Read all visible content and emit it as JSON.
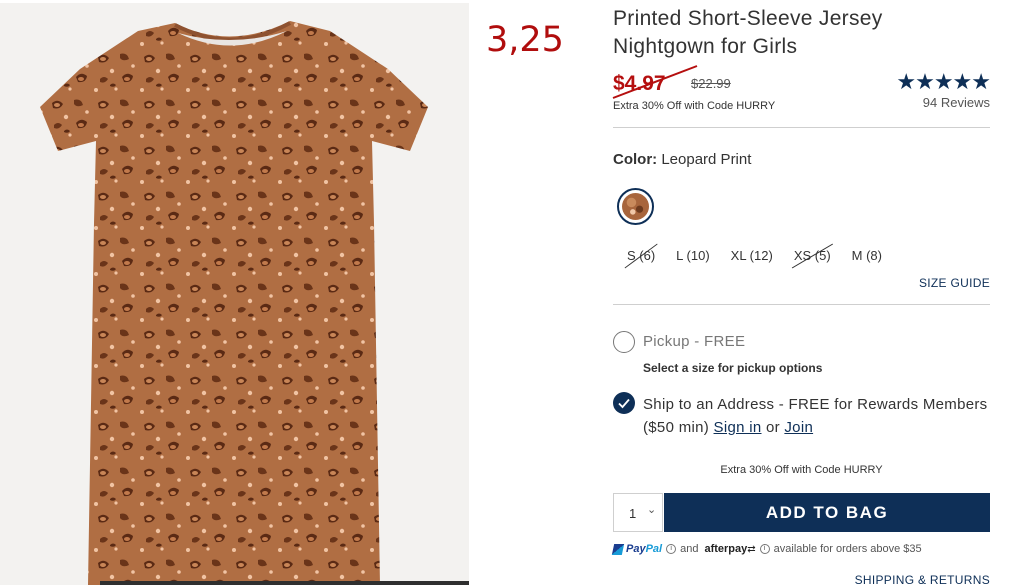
{
  "overlay": {
    "manual_price": "3,25"
  },
  "product": {
    "title": "Printed Short-Sleeve Jersey Nightgown for Girls",
    "price_now": "$4.97",
    "price_was": "$22.99",
    "promo_small": "Extra 30% Off with Code HURRY",
    "rating": {
      "stars": "★★★★★",
      "stars_value": 5,
      "reviews": "94 Reviews"
    },
    "color_label": "Color:",
    "color_value": "Leopard Print",
    "sizes": [
      {
        "label": "S (6)",
        "unavailable": true
      },
      {
        "label": "L (10)",
        "unavailable": false
      },
      {
        "label": "XL (12)",
        "unavailable": false
      },
      {
        "label": "XS (5)",
        "unavailable": true
      },
      {
        "label": "M (8)",
        "unavailable": false
      }
    ],
    "size_guide": "SIZE GUIDE"
  },
  "fulfillment": {
    "pickup_label": "Pickup - FREE",
    "pickup_note": "Select a size for pickup options",
    "ship_label": "Ship to an Address - FREE for Rewards Members ($50 min)",
    "sign_in": "Sign in",
    "or": "or",
    "join": "Join"
  },
  "cart": {
    "promo_center": "Extra 30% Off with Code HURRY",
    "quantity": "1",
    "quantity_chevron": "⌄",
    "add_label": "ADD TO BAG"
  },
  "payments": {
    "paypal_a": "Pay",
    "paypal_b": "Pal",
    "info": "i",
    "and": "and",
    "afterpay": "afterpay",
    "afterpay_mark": "⇄",
    "note": "available for orders above $35"
  },
  "footer": {
    "shipping": "SHIPPING & RETURNS"
  },
  "colors": {
    "navy": "#0e2f57",
    "sale_red": "#b50f0f",
    "leopard_base": "#a8653c"
  }
}
